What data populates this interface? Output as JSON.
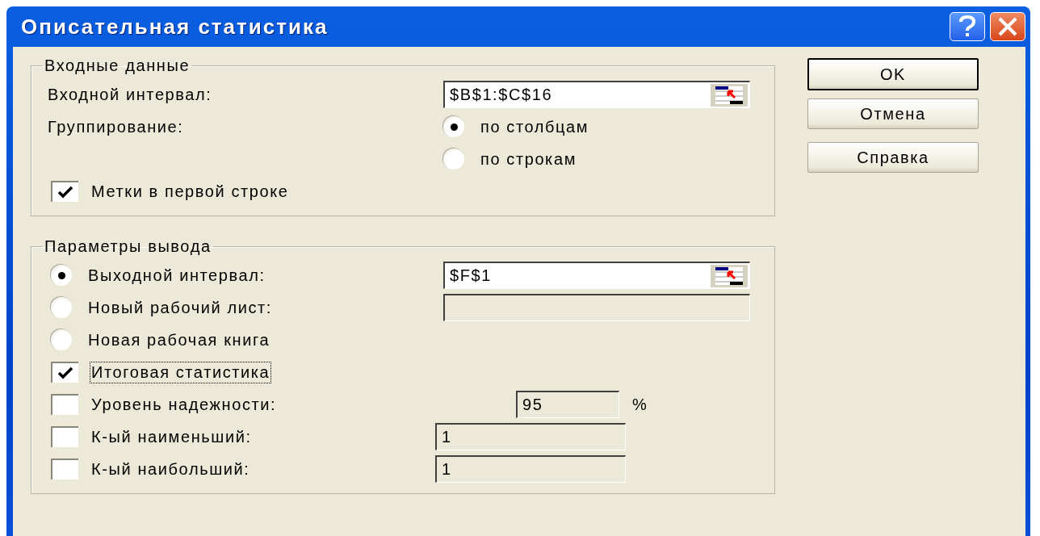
{
  "window": {
    "title": "Описательная статистика"
  },
  "input_group": {
    "legend": "Входные данные",
    "range_label": "Входной интервал:",
    "range_value": "$B$1:$C$16",
    "grouping_label": "Группирование:",
    "grouping_options": [
      {
        "label": "по столбцам",
        "selected": true
      },
      {
        "label": "по строкам",
        "selected": false
      }
    ],
    "labels_checkbox": {
      "label": "Метки в первой строке",
      "checked": true
    }
  },
  "output_group": {
    "legend": "Параметры вывода",
    "destinations": [
      {
        "kind": "range",
        "label": "Выходной интервал:",
        "selected": true,
        "value": "$F$1"
      },
      {
        "kind": "text",
        "label": "Новый рабочий лист:",
        "selected": false
      },
      {
        "kind": "plain",
        "label": "Новая рабочая книга",
        "selected": false
      }
    ],
    "options": [
      {
        "kind": "plain",
        "label": "Итоговая статистика",
        "checked": true,
        "focused": true
      },
      {
        "kind": "percent",
        "label": "Уровень надежности:",
        "checked": false,
        "focused": false,
        "value": "95",
        "unit": "%"
      },
      {
        "kind": "number",
        "label": "К-ый наименьший:",
        "checked": false,
        "focused": false,
        "value": "1"
      },
      {
        "kind": "number",
        "label": "К-ый наибольший:",
        "checked": false,
        "focused": false,
        "value": "1"
      }
    ]
  },
  "buttons": [
    {
      "label": "OK",
      "default": true
    },
    {
      "label": "Отмена",
      "default": false
    },
    {
      "label": "Справка",
      "default": false
    }
  ]
}
